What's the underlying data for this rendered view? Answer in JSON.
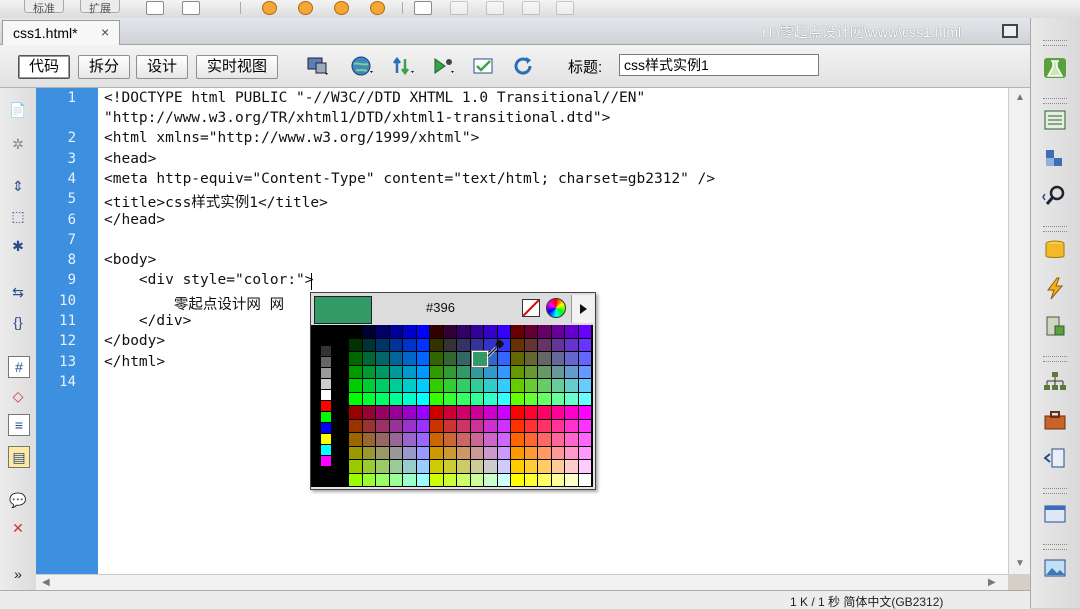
{
  "top_toolbar": {
    "buttons": [
      "标准",
      "扩展"
    ]
  },
  "document_tab": {
    "label": "css1.html*",
    "close": "×"
  },
  "path": "H:\\零起点设计网\\www\\css1.html",
  "view_buttons": [
    "代码",
    "拆分",
    "设计",
    "实时视图"
  ],
  "title_label": "标题:",
  "title_value": "css样式实例1",
  "line_numbers": [
    "1",
    "2",
    "3",
    "4",
    "5",
    "6",
    "7",
    "8",
    "9",
    "10",
    "11",
    "12",
    "13",
    "14"
  ],
  "code_lines": [
    "<!DOCTYPE html PUBLIC \"-//W3C//DTD XHTML 1.0 Transitional//EN\"",
    "\"http://www.w3.org/TR/xhtml1/DTD/xhtml1-transitional.dtd\">",
    "<html xmlns=\"http://www.w3.org/1999/xhtml\">",
    "<head>",
    "<meta http-equiv=\"Content-Type\" content=\"text/html; charset=gb2312\" />",
    "<title>css样式实例1</title>",
    "</head>",
    "",
    "<body>",
    "    <div style=\"color:\">",
    "        零起点设计网 网",
    "    </div>",
    "</body>",
    "</html>",
    ""
  ],
  "color_picker": {
    "hex": "#396",
    "preview_color": "#339966",
    "side_colors": [
      "#000000",
      "#333333",
      "#666666",
      "#999999",
      "#cccccc",
      "#ffffff",
      "#ff0000",
      "#00ff00",
      "#0000ff",
      "#ffff00",
      "#00ffff",
      "#ff00ff"
    ]
  },
  "status": "1 K / 1 秒  简体中文(GB2312)",
  "icons": {
    "left": [
      "file-icon",
      "gear-icon",
      "expand-icon",
      "select-tag-icon",
      "collapse-icon",
      "arrow-icon",
      "braces-icon",
      "hash-icon",
      "comment-html-icon",
      "wrap-icon",
      "format-icon",
      "comment-icon",
      "remove-comment-icon",
      "more-icon"
    ],
    "right": [
      "insert-icon",
      "css-styles-icon",
      "ap-elements-icon",
      "tag-inspector-icon",
      "files-icon",
      "assets-icon",
      "snippets-icon",
      "sitemap-icon",
      "toolbox-icon",
      "history-icon",
      "results-icon",
      "image-icon"
    ]
  }
}
